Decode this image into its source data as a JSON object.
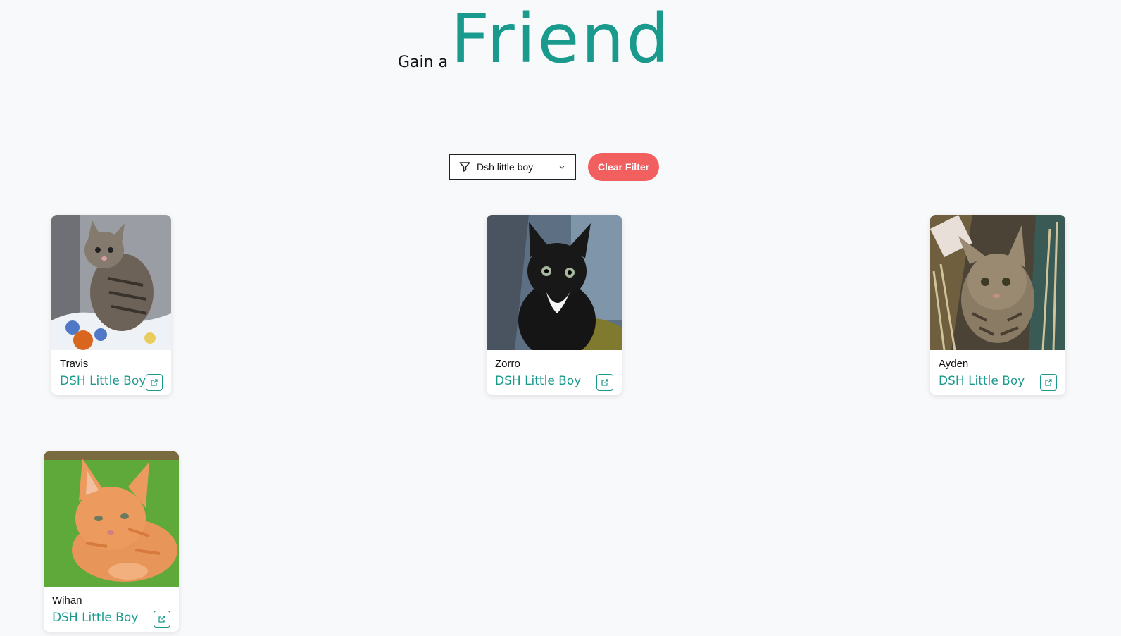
{
  "heading": {
    "prefix": "Gain a",
    "word": "Friend"
  },
  "filter": {
    "selected": "Dsh little boy",
    "icon": "filter-icon",
    "chevron_icon": "chevron-down-icon"
  },
  "clear_button": {
    "label": "Clear Filter"
  },
  "colors": {
    "accent": "#1a9a8d",
    "clear_button": "#f25f5f",
    "background": "#f8f9fb"
  },
  "pets": [
    {
      "name": "Travis",
      "breed": "DSH Little Boy",
      "link_icon": "external-link-icon"
    },
    {
      "name": "Zorro",
      "breed": "DSH Little Boy",
      "link_icon": "external-link-icon"
    },
    {
      "name": "Ayden",
      "breed": "DSH Little Boy",
      "link_icon": "external-link-icon"
    },
    {
      "name": "Wihan",
      "breed": "DSH Little Boy",
      "link_icon": "external-link-icon"
    }
  ]
}
